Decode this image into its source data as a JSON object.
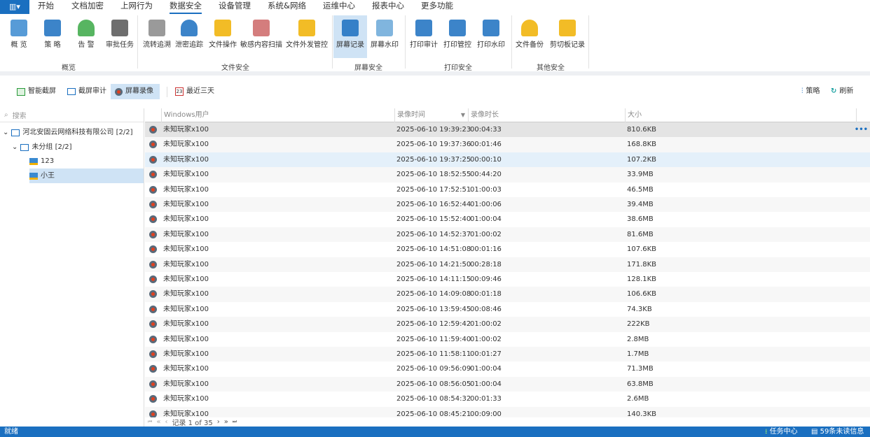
{
  "menu": {
    "app_icon": "app-menu-icon",
    "items": [
      "开始",
      "文档加密",
      "上网行为",
      "数据安全",
      "设备管理",
      "系统&网络",
      "运维中心",
      "报表中心",
      "更多功能"
    ],
    "active": "数据安全"
  },
  "ribbon": {
    "buttons": [
      "概 览",
      "策 略",
      "告 警",
      "审批任务",
      "流转追溯",
      "泄密追踪",
      "文件操作",
      "敏感内容扫描",
      "文件外发管控",
      "屏幕记录",
      "屏幕水印",
      "打印审计",
      "打印管控",
      "打印水印",
      "文件备份",
      "剪切板记录"
    ],
    "groups": [
      "概览",
      "文件安全",
      "屏幕安全",
      "打印安全",
      "其他安全"
    ],
    "selected": "屏幕记录"
  },
  "toolbar": {
    "smart_capture": "智能截屏",
    "capture_audit": "截屏审计",
    "screen_recording": "屏幕录像",
    "date_range": "最近三天",
    "policy": "策略",
    "refresh": "刷新"
  },
  "tree": {
    "search_placeholder": "搜索",
    "nodes": [
      {
        "label": "河北安固云网络科技有限公司  [2/2]"
      },
      {
        "label": "未分组  [2/2]"
      },
      {
        "label": "123"
      },
      {
        "label": "小王"
      }
    ],
    "selected": "小王"
  },
  "table": {
    "columns": [
      "Windows用户",
      "录像时间",
      "录像时长",
      "大小"
    ],
    "rows": [
      [
        "未知玩家x100",
        "2025-06-10 19:39:23",
        "00:04:33",
        "810.6KB"
      ],
      [
        "未知玩家x100",
        "2025-06-10 19:37:36",
        "00:01:46",
        "168.8KB"
      ],
      [
        "未知玩家x100",
        "2025-06-10 19:37:25",
        "00:00:10",
        "107.2KB"
      ],
      [
        "未知玩家x100",
        "2025-06-10 18:52:55",
        "00:44:20",
        "33.9MB"
      ],
      [
        "未知玩家x100",
        "2025-06-10 17:52:51",
        "01:00:03",
        "46.5MB"
      ],
      [
        "未知玩家x100",
        "2025-06-10 16:52:44",
        "01:00:06",
        "39.4MB"
      ],
      [
        "未知玩家x100",
        "2025-06-10 15:52:40",
        "01:00:04",
        "38.6MB"
      ],
      [
        "未知玩家x100",
        "2025-06-10 14:52:37",
        "01:00:02",
        "81.6MB"
      ],
      [
        "未知玩家x100",
        "2025-06-10 14:51:08",
        "00:01:16",
        "107.6KB"
      ],
      [
        "未知玩家x100",
        "2025-06-10 14:21:50",
        "00:28:18",
        "171.8KB"
      ],
      [
        "未知玩家x100",
        "2025-06-10 14:11:15",
        "00:09:46",
        "128.1KB"
      ],
      [
        "未知玩家x100",
        "2025-06-10 14:09:08",
        "00:01:18",
        "106.6KB"
      ],
      [
        "未知玩家x100",
        "2025-06-10 13:59:45",
        "00:08:46",
        "74.3KB"
      ],
      [
        "未知玩家x100",
        "2025-06-10 12:59:42",
        "01:00:02",
        "222KB"
      ],
      [
        "未知玩家x100",
        "2025-06-10 11:59:40",
        "01:00:02",
        "2.8MB"
      ],
      [
        "未知玩家x100",
        "2025-06-10 11:58:11",
        "00:01:27",
        "1.7MB"
      ],
      [
        "未知玩家x100",
        "2025-06-10 09:56:09",
        "01:00:04",
        "71.3MB"
      ],
      [
        "未知玩家x100",
        "2025-06-10 08:56:05",
        "01:00:04",
        "63.8MB"
      ],
      [
        "未知玩家x100",
        "2025-06-10 08:54:32",
        "00:01:33",
        "2.6MB"
      ],
      [
        "未知玩家x100",
        "2025-06-10 08:45:21",
        "00:09:00",
        "140.3KB"
      ]
    ],
    "more": "•••"
  },
  "pager": {
    "first": "⏮",
    "prev_page": "«",
    "prev": "‹",
    "text": "记录 1 of 35",
    "next": "›",
    "next_page": "»",
    "last": "⏭"
  },
  "status": {
    "text": "就绪",
    "task_center": "任务中心",
    "unread": "59条未读信息"
  },
  "colors": {
    "accent": "#1a6fc0",
    "selected": "#cfe3f5",
    "record": "#e0401f"
  }
}
